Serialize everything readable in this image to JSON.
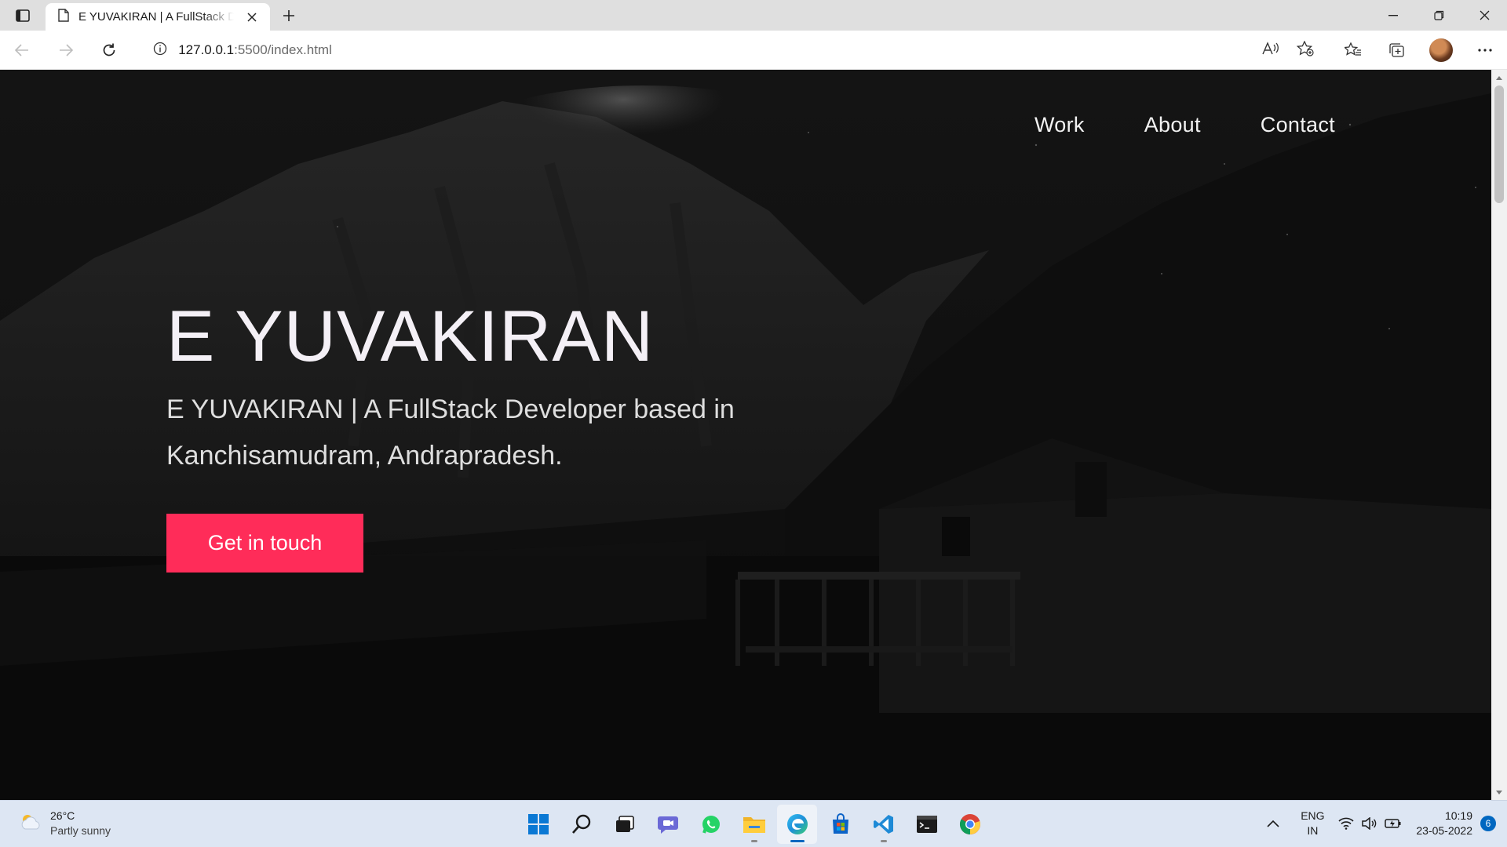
{
  "browser": {
    "tab_title": "E YUVAKIRAN | A FullStack Developer",
    "address_host": "127.0.0.1",
    "address_path": ":5500/index.html"
  },
  "hero": {
    "nav": [
      "Work",
      "About",
      "Contact"
    ],
    "name": "E YUVAKIRAN",
    "subtitle": "E YUVAKIRAN | A FullStack Developer based in Kanchisamudram, Andrapradesh.",
    "cta": "Get in touch",
    "cta_color": "#ff2c59"
  },
  "taskbar": {
    "weather_temp": "26°C",
    "weather_desc": "Partly sunny",
    "lang_1": "ENG",
    "lang_2": "IN",
    "time": "10:19",
    "date": "23-05-2022",
    "notifications": "6",
    "apps": [
      "windows-start-icon",
      "search-icon",
      "task-view-icon",
      "teams-chat-icon",
      "whatsapp-icon",
      "file-explorer-icon",
      "edge-icon",
      "microsoft-store-icon",
      "vscode-icon",
      "terminal-icon",
      "chrome-icon"
    ]
  }
}
